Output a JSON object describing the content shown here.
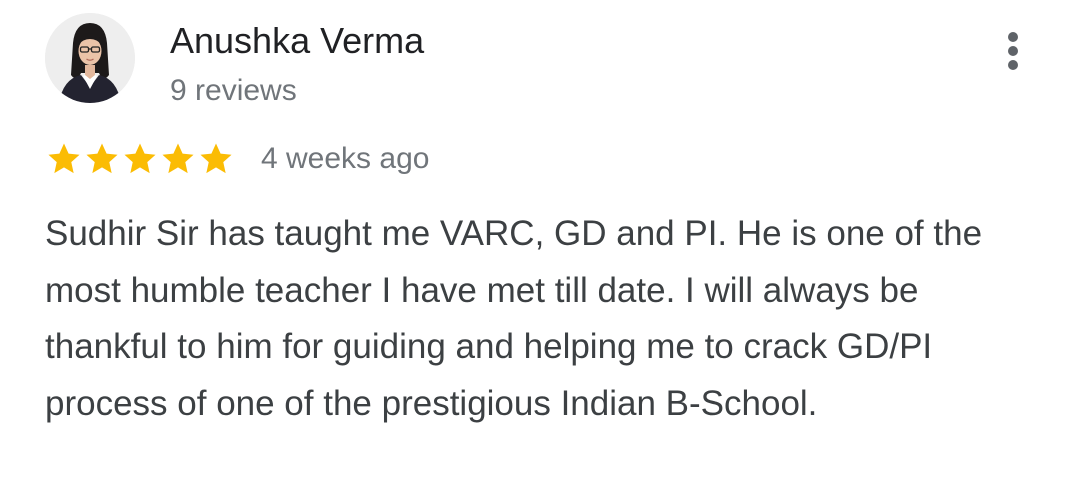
{
  "review": {
    "reviewer_name": "Anushka Verma",
    "review_count": "9 reviews",
    "rating": 5,
    "rating_max": 5,
    "date": "4 weeks ago",
    "text": "Sudhir Sir has taught me VARC, GD and PI. He is one of the most humble teacher I have met till date. I will always be thankful to him for guiding and helping me to crack GD/PI process of one of the prestigious Indian B-School."
  },
  "icons": {
    "more": "more-vert-icon",
    "star": "star-icon",
    "avatar": "profile-photo"
  },
  "colors": {
    "star": "#fbbc04",
    "secondary_text": "#70757a",
    "primary_text": "#202124",
    "body_text": "#3c4043",
    "menu_dots": "#5f6368"
  }
}
